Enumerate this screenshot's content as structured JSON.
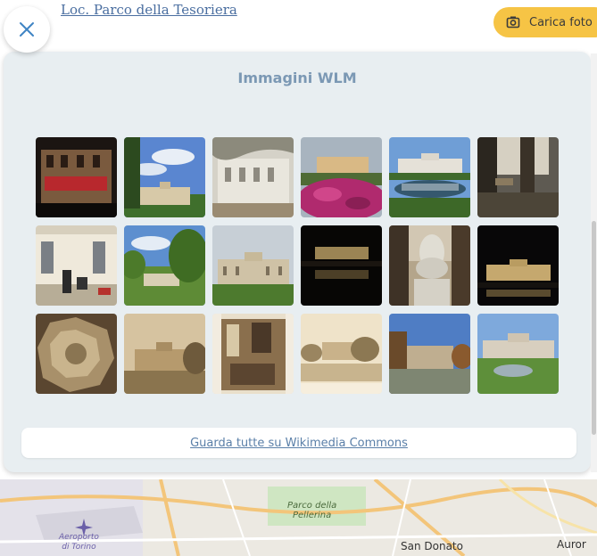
{
  "location": {
    "link_text": "Loc. Parco della Tesoriera"
  },
  "header": {
    "upload_label": "Carica foto"
  },
  "panel": {
    "title": "Immagini WLM",
    "commons_link": "Guarda tutte su Wikimedia Commons"
  },
  "images": [
    {
      "subject": "villa facade at night"
    },
    {
      "subject": "villa under blue sky"
    },
    {
      "subject": "villa behind trees"
    },
    {
      "subject": "villa with flower bed"
    },
    {
      "subject": "villa reflected in pond"
    },
    {
      "subject": "person seated in park"
    },
    {
      "subject": "building detail with people"
    },
    {
      "subject": "villa in park greenery"
    },
    {
      "subject": "villa front lawn"
    },
    {
      "subject": "villa night reflection"
    },
    {
      "subject": "statue monument"
    },
    {
      "subject": "villa illuminated at night"
    },
    {
      "subject": "ceiling fresco"
    },
    {
      "subject": "historic sepia villa"
    },
    {
      "subject": "historic interior room"
    },
    {
      "subject": "historic villa print"
    },
    {
      "subject": "villa with autumn trees"
    },
    {
      "subject": "villa with fountain"
    }
  ],
  "map": {
    "labels": {
      "park": "Parco della\nPellerina",
      "airport": "Aeroporto\ndi Torino",
      "district1": "San Donato",
      "district2": "Auror"
    }
  },
  "colors": {
    "accent_yellow": "#f6c445",
    "title_blue": "#7b98b4",
    "link_blue": "#5a7fa8"
  },
  "icons": {
    "close": "close-icon",
    "upload": "camera-icon"
  }
}
